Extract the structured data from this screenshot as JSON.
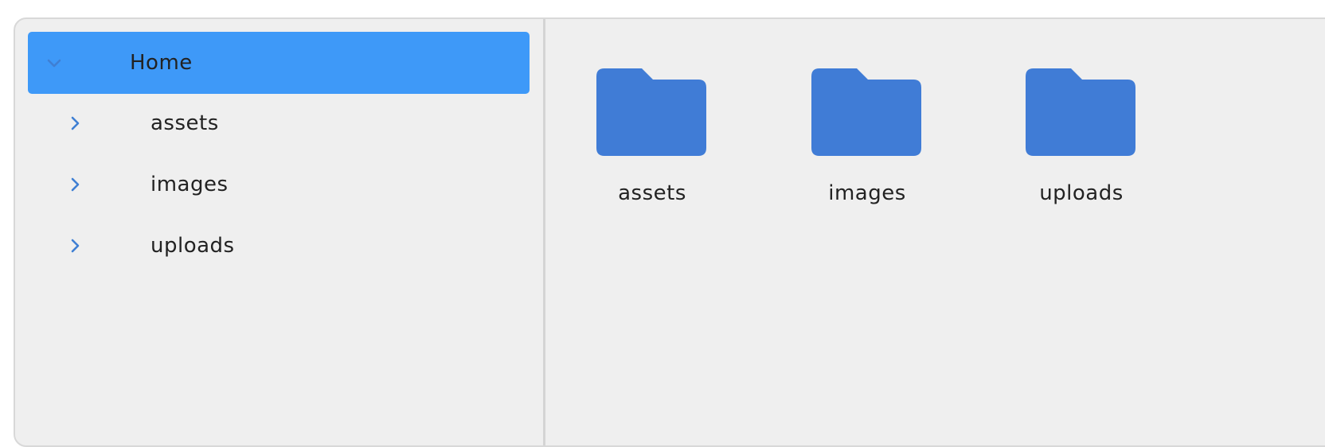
{
  "colors": {
    "selected_bg": "#3e99f8",
    "folder_fill": "#407cd6",
    "chevron": "#3f7fd3"
  },
  "sidebar": {
    "root": {
      "label": "Home",
      "expanded": true,
      "icon": "chevron-down-icon"
    },
    "children": [
      {
        "label": "assets",
        "icon": "chevron-right-icon"
      },
      {
        "label": "images",
        "icon": "chevron-right-icon"
      },
      {
        "label": "uploads",
        "icon": "chevron-right-icon"
      }
    ]
  },
  "content": {
    "folders": [
      {
        "label": "assets",
        "icon": "folder-icon"
      },
      {
        "label": "images",
        "icon": "folder-icon"
      },
      {
        "label": "uploads",
        "icon": "folder-icon"
      }
    ]
  }
}
